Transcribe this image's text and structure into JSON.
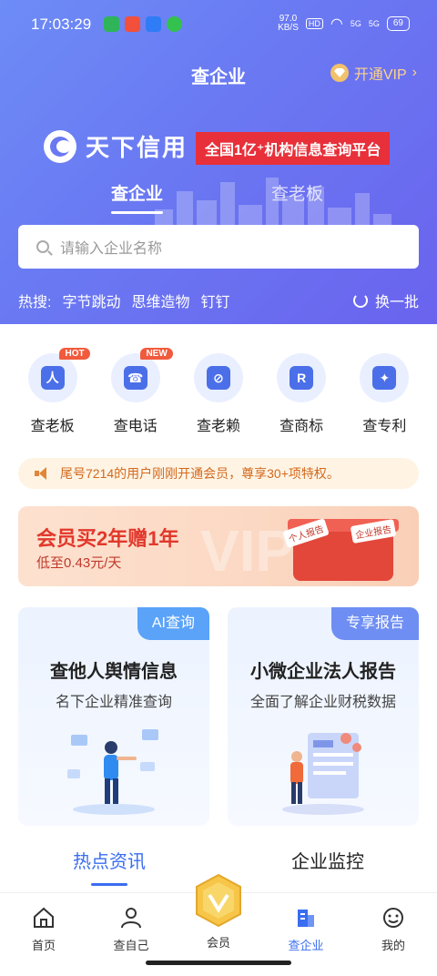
{
  "status_bar": {
    "time": "17:03:29",
    "net_speed_value": "97.0",
    "net_speed_unit": "KB/S",
    "hd": "HD",
    "sig1": "5G",
    "sig2": "5G",
    "battery": "69"
  },
  "nav": {
    "title": "查企业",
    "vip_label": "开通VIP",
    "vip_arrow": "›"
  },
  "brand": {
    "name": "天下信用",
    "slogan": "全国1亿⁺机构信息查询平台"
  },
  "search_tabs": {
    "active": "查企业",
    "inactive": "查老板"
  },
  "search": {
    "placeholder": "请输入企业名称"
  },
  "hot": {
    "label": "热搜:",
    "words": [
      "字节跳动",
      "思维造物",
      "钉钉"
    ],
    "refresh": "换一批"
  },
  "quick_items": [
    {
      "label": "查老板",
      "badge": "HOT",
      "glyph": "人"
    },
    {
      "label": "查电话",
      "badge": "NEW",
      "glyph": "☎"
    },
    {
      "label": "查老赖",
      "badge": "",
      "glyph": "⊘"
    },
    {
      "label": "查商标",
      "badge": "",
      "glyph": "R"
    },
    {
      "label": "查专利",
      "badge": "",
      "glyph": "✦"
    }
  ],
  "notice": {
    "text": "尾号7214的用户刚刚开通会员，尊享30+项特权。"
  },
  "vip_banner": {
    "title": "会员买2年赠1年",
    "sub": "低至0.43元/天",
    "watermark": "VIP",
    "tag1": "个人报告",
    "tag2": "企业报告"
  },
  "cards": [
    {
      "corner": "AI查询",
      "title": "查他人舆情信息",
      "sub": "名下企业精准查询"
    },
    {
      "corner": "专享报告",
      "title": "小微企业法人报告",
      "sub": "全面了解企业财税数据"
    }
  ],
  "section_tabs": {
    "active": "热点资讯",
    "inactive": "企业监控"
  },
  "bottom_nav": [
    {
      "label": "首页",
      "icon": "home-icon"
    },
    {
      "label": "查自己",
      "icon": "person-icon"
    },
    {
      "label": "会员",
      "icon": "member-badge-icon"
    },
    {
      "label": "查企业",
      "icon": "building-icon"
    },
    {
      "label": "我的",
      "icon": "smile-icon"
    }
  ],
  "colors": {
    "primary": "#3a6df0",
    "header_gradient_start": "#6d8cf6",
    "header_gradient_end": "#6a63ee",
    "slogan_red": "#e8303a",
    "vip_gold": "#ffd38a"
  }
}
